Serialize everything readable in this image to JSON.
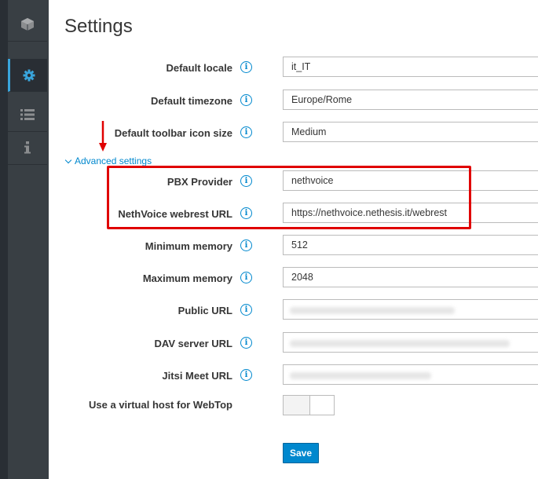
{
  "page": {
    "title": "Settings"
  },
  "sidebar": {
    "items": [
      {
        "icon": "cube-icon"
      },
      {
        "icon": "gear-icon",
        "active": true
      },
      {
        "icon": "list-icon"
      },
      {
        "icon": "info-icon"
      }
    ]
  },
  "form": {
    "default_locale": {
      "label": "Default locale",
      "value": "it_IT"
    },
    "default_timezone": {
      "label": "Default timezone",
      "value": "Europe/Rome"
    },
    "toolbar_icon_size": {
      "label": "Default toolbar icon size",
      "value": "Medium"
    },
    "advanced_toggle": "Advanced settings",
    "pbx_provider": {
      "label": "PBX Provider",
      "value": "nethvoice"
    },
    "webrest_url": {
      "label": "NethVoice webrest URL",
      "value": "https://nethvoice.nethesis.it/webrest"
    },
    "min_memory": {
      "label": "Minimum memory",
      "value": "512"
    },
    "max_memory": {
      "label": "Maximum memory",
      "value": "2048"
    },
    "public_url": {
      "label": "Public URL",
      "value": ""
    },
    "dav_url": {
      "label": "DAV server URL",
      "value": ""
    },
    "jitsi_url": {
      "label": "Jitsi Meet URL",
      "value": ""
    },
    "virtual_host": {
      "label": "Use a virtual host for WebTop",
      "enabled": false
    },
    "info_glyph": "i",
    "save_label": "Save"
  },
  "colors": {
    "accent": "#0088ce",
    "highlight": "#e00000",
    "sidebar": "#393f44"
  }
}
